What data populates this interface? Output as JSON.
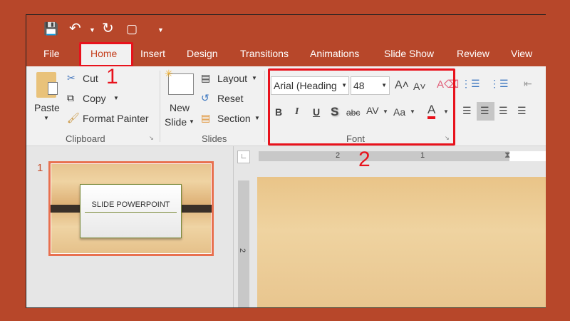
{
  "quick_access": {
    "icons": [
      "save-icon",
      "undo-icon",
      "redo-icon",
      "start-from-beginning-icon",
      "customize-icon"
    ]
  },
  "tabs": [
    "File",
    "Home",
    "Insert",
    "Design",
    "Transitions",
    "Animations",
    "Slide Show",
    "Review",
    "View"
  ],
  "active_tab": "Home",
  "annotations": {
    "one": "1",
    "two": "2"
  },
  "clipboard": {
    "paste": "Paste",
    "cut": "Cut",
    "copy": "Copy",
    "format_painter": "Format Painter",
    "label": "Clipboard"
  },
  "slides": {
    "new_slide_1": "New",
    "new_slide_2": "Slide",
    "layout": "Layout",
    "reset": "Reset",
    "section": "Section",
    "label": "Slides"
  },
  "font": {
    "name": "Arial (Heading",
    "size": "48",
    "bold": "B",
    "italic": "I",
    "underline": "U",
    "shadow": "S",
    "strike": "abc",
    "spacing": "AV",
    "case": "Aa",
    "color_letter": "A",
    "label": "Font",
    "font_color": "#e8121c"
  },
  "ruler": {
    "h_labels": [
      "2",
      "1"
    ],
    "v_labels": [
      "2"
    ]
  },
  "thumbnail": {
    "number": "1",
    "title": "SLIDE POWERPOINT"
  },
  "colors": {
    "accent": "#b7472a",
    "annotation": "#e8121c"
  }
}
